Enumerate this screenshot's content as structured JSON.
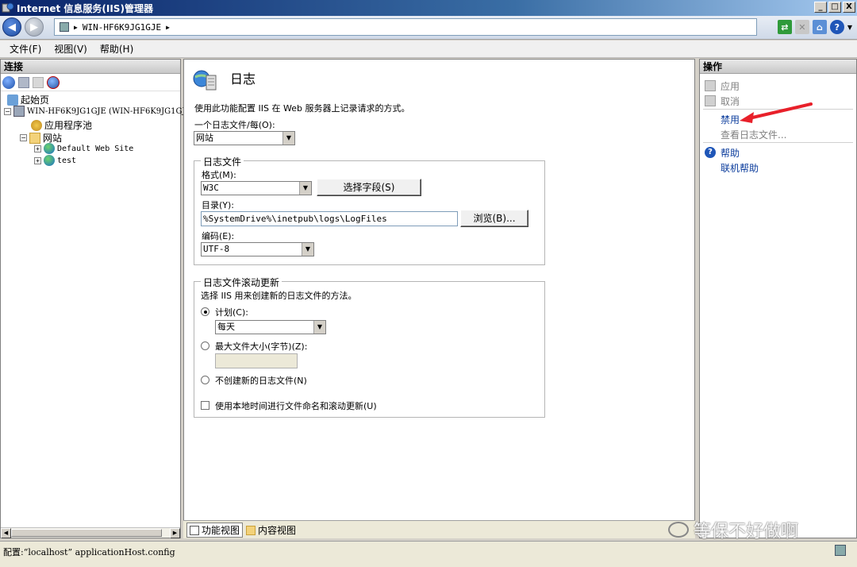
{
  "window": {
    "title": "Internet 信息服务(IIS)管理器",
    "controls": [
      "_",
      "□",
      "X"
    ]
  },
  "address": {
    "path": "WIN-HF6K9JG1GJE"
  },
  "menu": {
    "items": [
      "文件(F)",
      "视图(V)",
      "帮助(H)"
    ]
  },
  "connections": {
    "header": "连接",
    "tree": [
      {
        "label": "起始页",
        "level": 0
      },
      {
        "label": "WIN-HF6K9JG1GJE (WIN-HF6K9JG1GJE\\",
        "level": 0
      },
      {
        "label": "应用程序池",
        "level": 1
      },
      {
        "label": "网站",
        "level": 1
      },
      {
        "label": "Default Web Site",
        "level": 2
      },
      {
        "label": "test",
        "level": 2
      }
    ]
  },
  "main": {
    "title": "日志",
    "description": "使用此功能配置 IIS 在 Web 服务器上记录请求的方式。",
    "per_log_label": "一个日志文件/每(O):",
    "per_log_value": "网站",
    "logfile_group": "日志文件",
    "format_label": "格式(M):",
    "format_value": "W3C",
    "select_fields_button": "选择字段(S)",
    "directory_label": "目录(Y):",
    "directory_value": "%SystemDrive%\\inetpub\\logs\\LogFiles",
    "browse_button": "浏览(B)...",
    "encoding_label": "编码(E):",
    "encoding_value": "UTF-8",
    "rollover_group": "日志文件滚动更新",
    "rollover_desc": "选择 IIS 用来创建新的日志文件的方法。",
    "schedule_label": "计划(C):",
    "schedule_value": "每天",
    "maxsize_label": "最大文件大小(字节)(Z):",
    "maxsize_value": "",
    "nocreate_label": "不创建新的日志文件(N)",
    "localtime_label": "使用本地时间进行文件命名和滚动更新(U)",
    "view_tabs": [
      "功能视图",
      "内容视图"
    ]
  },
  "actions": {
    "header": "操作",
    "apply": "应用",
    "cancel": "取消",
    "disable": "禁用",
    "view_logs": "查看日志文件...",
    "help": "帮助",
    "online_help": "联机帮助"
  },
  "status": {
    "text": "配置:“localhost” applicationHost.config"
  },
  "watermark": {
    "text": "等保不好做啊"
  },
  "colors": {
    "link": "#0b3c9c",
    "annotation_arrow": "#e8202a"
  }
}
